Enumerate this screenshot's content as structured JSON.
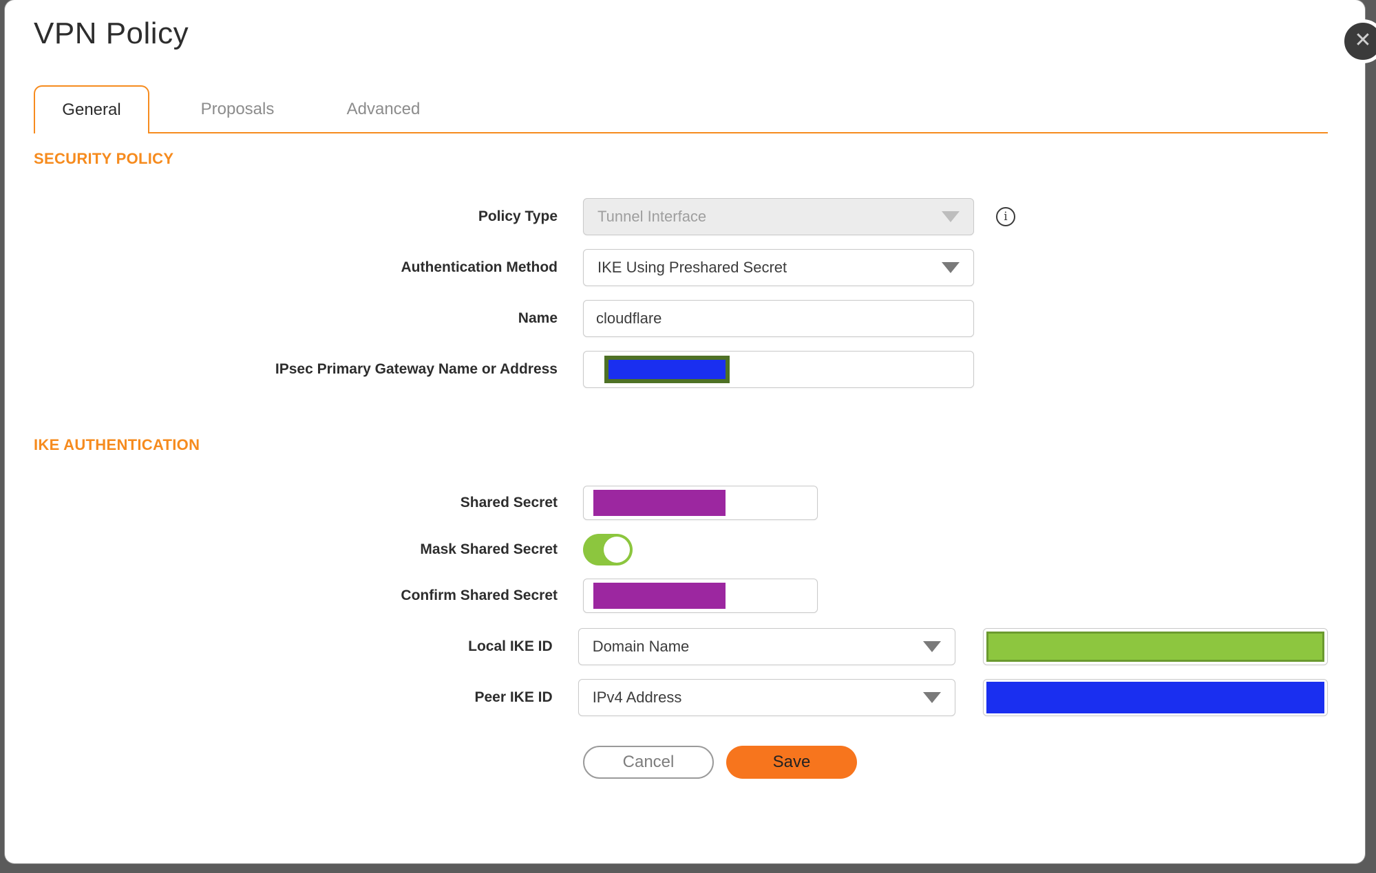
{
  "dialog": {
    "title": "VPN Policy",
    "close_glyph": "✕"
  },
  "tabs": [
    {
      "label": "General",
      "active": true
    },
    {
      "label": "Proposals",
      "active": false
    },
    {
      "label": "Advanced",
      "active": false
    }
  ],
  "sections": {
    "security_policy": "SECURITY POLICY",
    "ike_authentication": "IKE AUTHENTICATION"
  },
  "fields": {
    "policy_type": {
      "label": "Policy Type",
      "value": "Tunnel Interface",
      "disabled": true
    },
    "authentication_method": {
      "label": "Authentication Method",
      "value": "IKE Using Preshared Secret"
    },
    "name": {
      "label": "Name",
      "value": "cloudflare"
    },
    "ipsec_gateway": {
      "label": "IPsec Primary Gateway Name or Address",
      "value": "",
      "redaction": "blue-box"
    },
    "shared_secret": {
      "label": "Shared Secret",
      "value": "",
      "redaction": "purple-box"
    },
    "mask_shared_secret": {
      "label": "Mask Shared Secret",
      "state": "on"
    },
    "confirm_shared_secret": {
      "label": "Confirm Shared Secret",
      "value": "",
      "redaction": "purple-box"
    },
    "local_ike_id": {
      "label": "Local IKE ID",
      "value": "Domain Name",
      "redaction": "green-box"
    },
    "peer_ike_id": {
      "label": "Peer IKE ID",
      "value": "IPv4 Address",
      "redaction": "blue-box"
    },
    "info_glyph": "i"
  },
  "buttons": {
    "cancel": "Cancel",
    "save": "Save"
  },
  "colors": {
    "accent_orange": "#f68b1e",
    "save_orange": "#f7751d",
    "redact_purple": "#9c27a0",
    "redact_blue": "#1a2ff0",
    "redact_green": "#8dc63f",
    "toggle_green": "#8cc63e"
  }
}
